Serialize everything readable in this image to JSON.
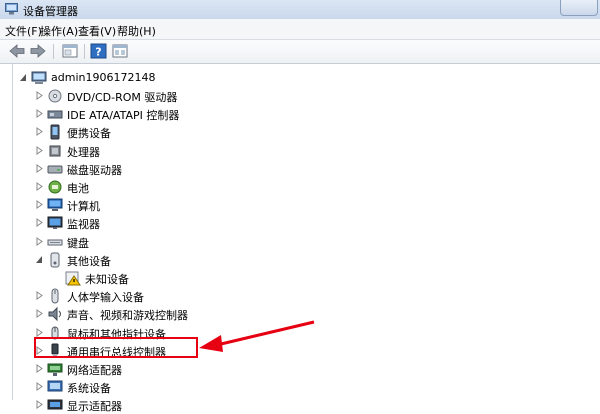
{
  "window": {
    "title": "设备管理器"
  },
  "menu": [
    "文件(F)",
    "操作(A)",
    "查看(V)",
    "帮助(H)"
  ],
  "toolbar": {
    "buttons": [
      "back-icon",
      "forward-icon",
      "properties-icon",
      "help-icon",
      "show-panel-icon"
    ]
  },
  "tree": {
    "root": "admin1906172148",
    "nodes": [
      {
        "label": "DVD/CD-ROM 驱动器",
        "icon": "dvd-drive-icon",
        "expanded": false
      },
      {
        "label": "IDE ATA/ATAPI 控制器",
        "icon": "ide-controller-icon",
        "expanded": false
      },
      {
        "label": "便携设备",
        "icon": "portable-device-icon",
        "expanded": false
      },
      {
        "label": "处理器",
        "icon": "processor-icon",
        "expanded": false
      },
      {
        "label": "磁盘驱动器",
        "icon": "disk-drive-icon",
        "expanded": false
      },
      {
        "label": "电池",
        "icon": "battery-icon",
        "expanded": false
      },
      {
        "label": "计算机",
        "icon": "computer-icon",
        "expanded": false
      },
      {
        "label": "监视器",
        "icon": "monitor-icon",
        "expanded": false
      },
      {
        "label": "键盘",
        "icon": "keyboard-icon",
        "expanded": false
      },
      {
        "label": "其他设备",
        "icon": "other-devices-icon",
        "expanded": true,
        "children": [
          {
            "label": "未知设备",
            "icon": "unknown-device-warning-icon"
          }
        ]
      },
      {
        "label": "人体学输入设备",
        "icon": "hid-icon",
        "expanded": false
      },
      {
        "label": "声音、视频和游戏控制器",
        "icon": "sound-icon",
        "expanded": false
      },
      {
        "label": "鼠标和其他指针设备",
        "icon": "mouse-icon",
        "expanded": false
      },
      {
        "label": "通用串行总线控制器",
        "icon": "usb-icon",
        "expanded": false,
        "highlighted": true
      },
      {
        "label": "网络适配器",
        "icon": "network-adapter-icon",
        "expanded": false
      },
      {
        "label": "系统设备",
        "icon": "system-device-icon",
        "expanded": false
      },
      {
        "label": "显示适配器",
        "icon": "display-adapter-icon",
        "expanded": false
      }
    ]
  },
  "colors": {
    "annotation": "#e60012"
  }
}
